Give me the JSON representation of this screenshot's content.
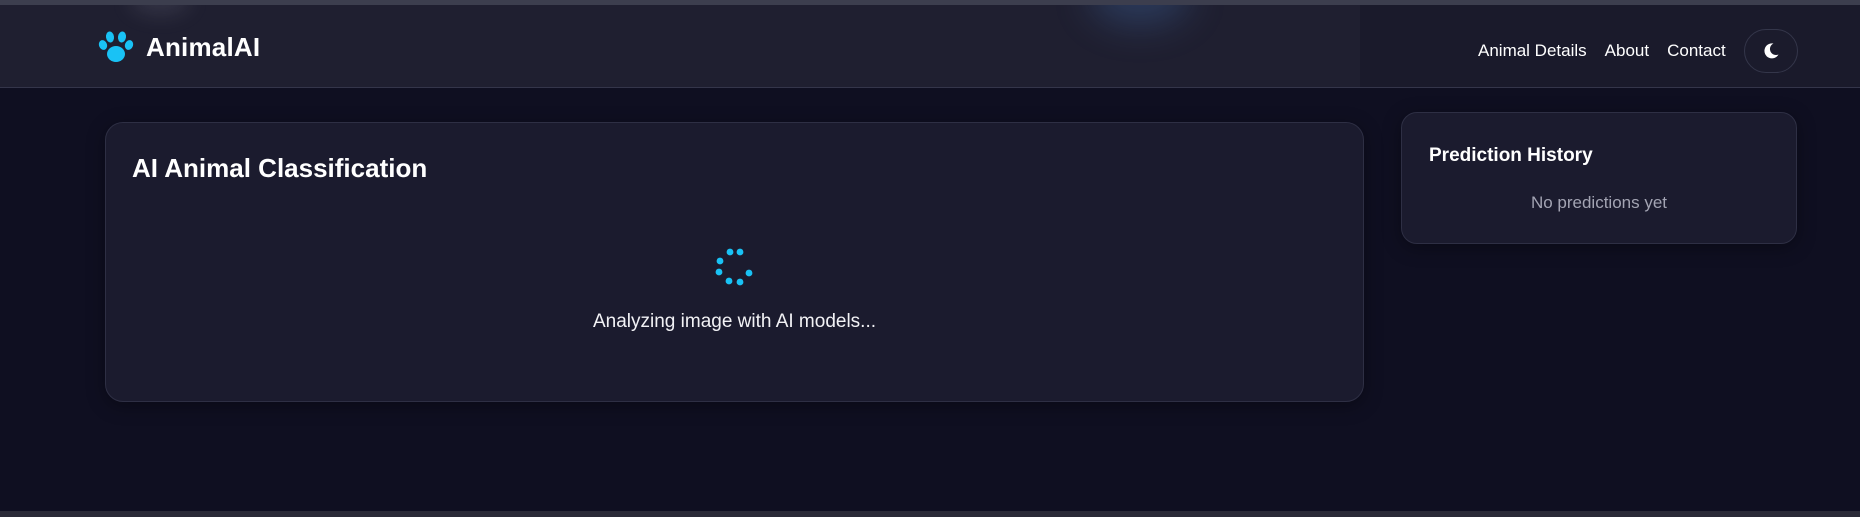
{
  "navbar": {
    "brand": "AnimalAI",
    "brand_icon": "paw-icon",
    "links": [
      "Animal Details",
      "About",
      "Contact"
    ],
    "theme_toggle_icon": "moon-icon"
  },
  "classification": {
    "title": "AI Animal Classification",
    "loading_text": "Analyzing image with AI models...",
    "spinner_icon": "loading-spinner-icon"
  },
  "history": {
    "title": "Prediction History",
    "empty_text": "No predictions yet"
  },
  "colors": {
    "accent": "#19c2f5",
    "background": "#0f0f21",
    "card": "#1b1b2e"
  }
}
